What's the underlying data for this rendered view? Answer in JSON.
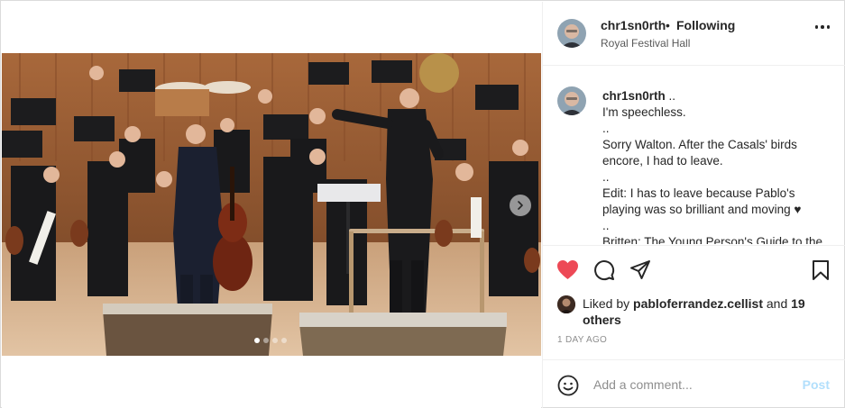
{
  "post": {
    "username": "chr1sn0rth",
    "follow_state": "Following",
    "separator": "•",
    "location": "Royal Festival Hall"
  },
  "caption": {
    "username": "chr1sn0rth",
    "lines": [
      "..",
      "I'm speechless.",
      "..",
      "Sorry Walton. After the Casals' birds",
      "encore, I had to leave.",
      "..",
      "Edit: I has to leave because Pablo's",
      "playing was so brilliant and moving ♥",
      "..",
      "Britten: The Young Person's Guide to the"
    ]
  },
  "likes": {
    "prefix": "Liked by",
    "user": "pabloferrandez.cellist",
    "joiner": "and",
    "others": "19 others"
  },
  "date": "1 DAY AGO",
  "comment": {
    "placeholder": "Add a comment...",
    "post_label": "Post"
  },
  "carousel": {
    "total": 4,
    "active_index": 0
  },
  "colors": {
    "like_red": "#ed4956",
    "post_disabled": "#b2dffc",
    "text": "#262626",
    "muted": "#8e8e8e"
  },
  "icons": [
    "more-options-icon",
    "heart-icon",
    "comment-icon",
    "share-icon",
    "bookmark-icon",
    "emoji-icon",
    "chevron-right-icon"
  ]
}
